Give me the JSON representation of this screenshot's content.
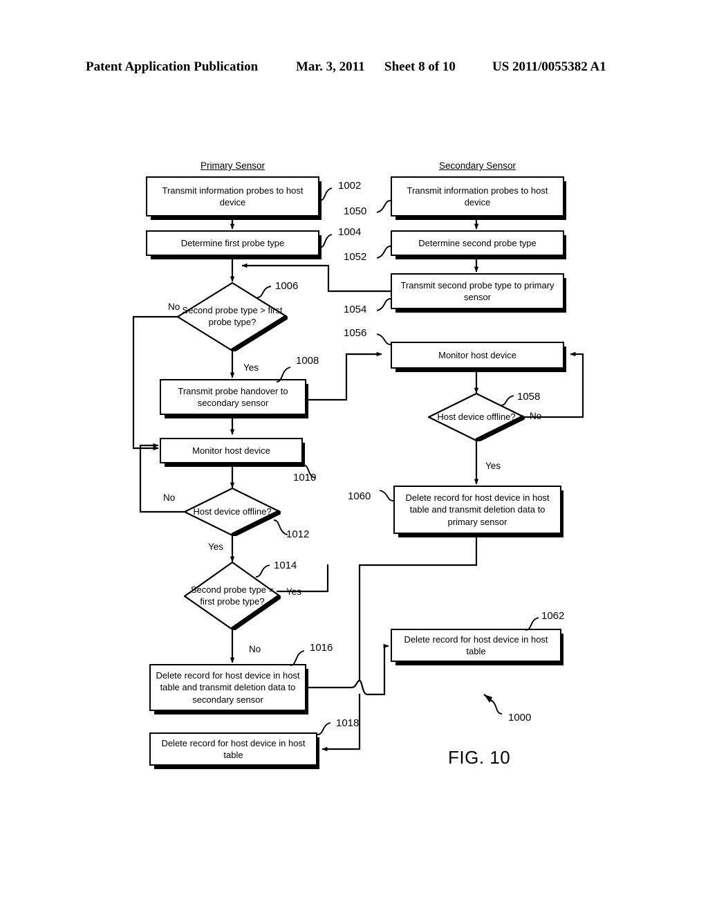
{
  "header": {
    "title": "Patent Application Publication",
    "date": "Mar. 3, 2011",
    "sheet": "Sheet 8 of 10",
    "pub_number": "US 2011/0055382 A1"
  },
  "figure": {
    "caption": "FIG. 10",
    "figure_ref": "1000"
  },
  "columns": {
    "primary": "Primary Sensor",
    "secondary": "Secondary Sensor"
  },
  "nodes": {
    "n1002": {
      "ref": "1002",
      "text": "Transmit information probes to host device",
      "shape": "process"
    },
    "n1004": {
      "ref": "1004",
      "text": "Determine first probe type",
      "shape": "process"
    },
    "n1006": {
      "ref": "1006",
      "text": "Second probe type > first probe type?",
      "shape": "decision"
    },
    "n1008": {
      "ref": "1008",
      "text": "Transmit probe handover to secondary sensor",
      "shape": "process"
    },
    "n1010": {
      "ref": "1010",
      "text": "Monitor host device",
      "shape": "process"
    },
    "n1012": {
      "ref": "1012",
      "text": "Host device offline?",
      "shape": "decision"
    },
    "n1014": {
      "ref": "1014",
      "text": "Second probe type = first probe type?",
      "shape": "decision"
    },
    "n1016": {
      "ref": "1016",
      "text": "Delete record for host device in host table and transmit deletion data to secondary sensor",
      "shape": "process"
    },
    "n1018": {
      "ref": "1018",
      "text": "Delete record for host device in host table",
      "shape": "process"
    },
    "n1050": {
      "ref": "1050",
      "text": "Transmit information probes to host device",
      "shape": "process"
    },
    "n1052": {
      "ref": "1052",
      "text": "Determine second probe type",
      "shape": "process"
    },
    "n1054": {
      "ref": "1054",
      "text": "Transmit second probe type to primary sensor",
      "shape": "process"
    },
    "n1056": {
      "ref": "1056",
      "text": "Monitor host device",
      "shape": "process"
    },
    "n1058": {
      "ref": "1058",
      "text": "Host device offline?",
      "shape": "decision"
    },
    "n1060": {
      "ref": "1060",
      "text": "Delete record for host device in host table and transmit deletion data to primary sensor",
      "shape": "process"
    },
    "n1062": {
      "ref": "1062",
      "text": "Delete record for host device in host table",
      "shape": "process"
    }
  },
  "branch_labels": {
    "b1006_no": "No",
    "b1006_yes": "Yes",
    "b1012_no": "No",
    "b1012_yes": "Yes",
    "b1014_yes": "Yes",
    "b1014_no": "No",
    "b1058_no": "No",
    "b1058_yes": "Yes"
  }
}
